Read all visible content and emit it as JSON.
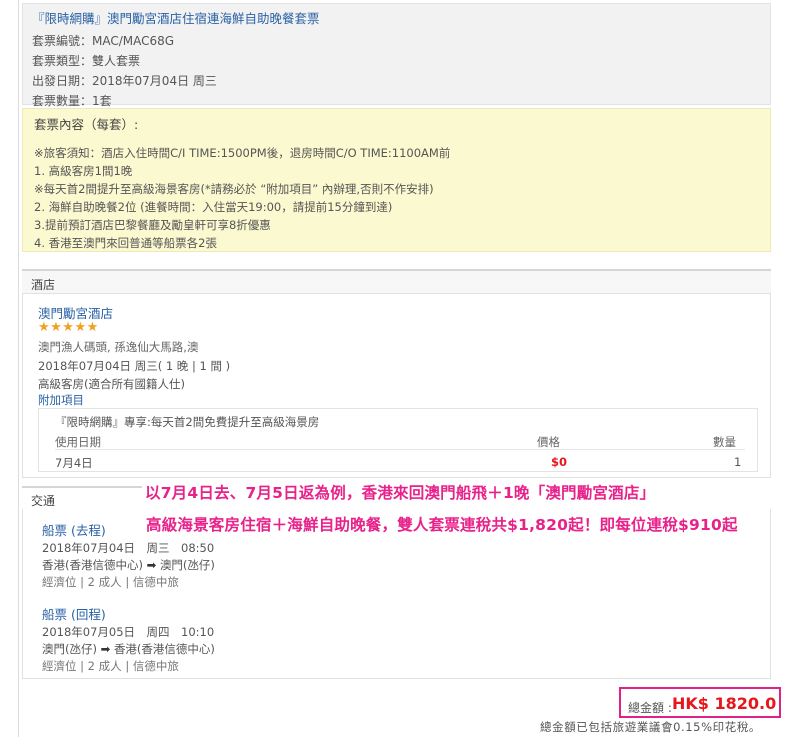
{
  "package": {
    "title": "『限時網購』澳門勵宮酒店住宿連海鮮自助晚餐套票",
    "code": "套票編號：MAC/MAC68G",
    "type": "套票類型：雙人套票",
    "departure": "出發日期：2018年07月04日 周三",
    "quantity": "套票數量：1套"
  },
  "contents": {
    "heading": "套票內容（每套）:",
    "lines": [
      "※旅客須知：酒店入住時間C/I TIME:1500PM後，退房時間C/O TIME:1100AM前",
      "1. 高級客房1間1晚",
      "※每天首2間提升至高級海景客房(*請務必於 “附加項目” 內辦理,否則不作安排)",
      "2. 海鮮自助晚餐2位 (進餐時間：入住當天19:00，請提前15分鐘到達)",
      "3.提前預訂酒店巴黎餐廳及勵皇軒可享8折優惠",
      "4. 香港至澳門來回普通等船票各2張"
    ]
  },
  "hotel": {
    "section_label": "酒店",
    "name": "澳門勵宮酒店",
    "stars": "★★★★★",
    "star_rating": 5,
    "address": "澳門漁人碼頭, 孫逸仙大馬路,澳",
    "stay": "2018年07月04日 周三( 1 晚 | 1 間 )",
    "room": "高級客房(適合所有國籍人仕)",
    "addon_link": "附加項目",
    "addon": {
      "title": "『限時網購』專享:每天首2間免費提升至高級海景房",
      "col_date": "使用日期",
      "col_price": "價格",
      "col_qty": "數量",
      "date": "7月4日",
      "price": "$0",
      "qty": "1"
    }
  },
  "transport": {
    "section_label": "交通",
    "outbound": {
      "title": "船票 (去程)",
      "datetime": "2018年07月04日　周三　08:50",
      "route_from": "香港(香港信德中心)",
      "route_to": "澳門(氹仔)",
      "details": "經濟位 | 2 成人 | 信德中旅"
    },
    "return": {
      "title": "船票 (回程)",
      "datetime": "2018年07月05日　周四　10:10",
      "route_from": "澳門(氹仔)",
      "route_to": "香港(香港信德中心)",
      "details": "經濟位 | 2 成人 | 信德中旅"
    },
    "arrow": "➡"
  },
  "promo": {
    "line1": "以7月4日去、7月5日返為例，香港來回澳門船飛＋1晚「澳門勵宮酒店」",
    "line2": "高級海景客房住宿＋海鮮自助晚餐，雙人套票連稅共$1,820起！即每位連稅$910起"
  },
  "total": {
    "label": "總金額 :",
    "amount": "HK$ 1820.0",
    "note": "總金額已包括旅遊業議會0.15%印花稅。"
  },
  "colors": {
    "link_blue": "#2a62a6",
    "promo_pink": "#e8228a",
    "price_red": "#e8161b",
    "star_orange": "#f0a11f",
    "contents_bg": "#fbf9cf"
  }
}
